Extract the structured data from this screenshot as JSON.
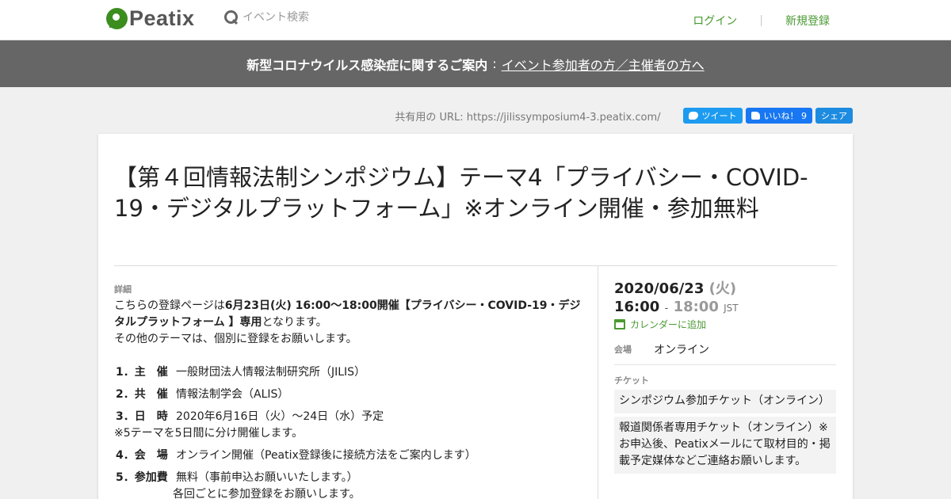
{
  "header": {
    "logo_text": "Peatix",
    "search_placeholder": "イベント検索",
    "login": "ログイン",
    "signup": "新規登録",
    "separator": "|"
  },
  "notice": {
    "title": "新型コロナウイルス感染症に関するご案内",
    "colon": ":",
    "link": "イベント参加者の方／主催者の方へ"
  },
  "share": {
    "url_text": "共有用の URL: https://jilissymposium4-3.peatix.com/",
    "tweet": "ツイート",
    "like": "いいね！ 9",
    "share": "シェア"
  },
  "event": {
    "title": "【第４回情報法制シンポジウム】テーマ4「プライバシー・COVID-19・デジタルプラットフォーム」※オンライン開催・参加無料",
    "details_label": "詳細",
    "desc_pre": "こちらの登録ページは",
    "desc_bold": "6月23日(火) 16:00～18:00開催【プライバシー・COVID-19・デジタルプラットフォーム 】専用",
    "desc_post": "となります。",
    "desc_line2": "その他のテーマは、個別に登録をお願いします。",
    "info": [
      {
        "key": "1．主　催",
        "value": "一般財団法人情報法制研究所（JILIS）"
      },
      {
        "key": "2．共　催",
        "value": "情報法制学会（ALIS）"
      },
      {
        "key": "3．日　時",
        "value": "2020年6月16日（火）～24日（水）予定",
        "extra": "※5テーマを5日間に分け開催します。"
      },
      {
        "key": "4．会　場",
        "value": "オンライン開催（Peatix登録後に接続方法をご案内します）"
      },
      {
        "key": "5．参加費",
        "value": "無料（事前申込お願いいたします。）",
        "sub": "各回ごとに参加登録をお願いします。"
      }
    ]
  },
  "sidebar": {
    "date": "2020/06/23",
    "dow": "(火)",
    "start": "16:00",
    "dash": "-",
    "end": "18:00",
    "tz": "JST",
    "calendar": "カレンダーに追加",
    "venue_label": "会場",
    "venue": "オンライン",
    "ticket_label": "チケット",
    "tickets": [
      "シンポジウム参加チケット（オンライン）",
      "報道関係者専用チケット（オンライン）※お申込後、Peatixメールにて取材目的・掲載予定媒体などご連絡お願いします。"
    ]
  },
  "colors": {
    "brand": "#3b8e1e",
    "link": "#4a9a32",
    "notice_bg": "#666666",
    "twitter": "#1d9bf0",
    "facebook": "#1877f2"
  }
}
